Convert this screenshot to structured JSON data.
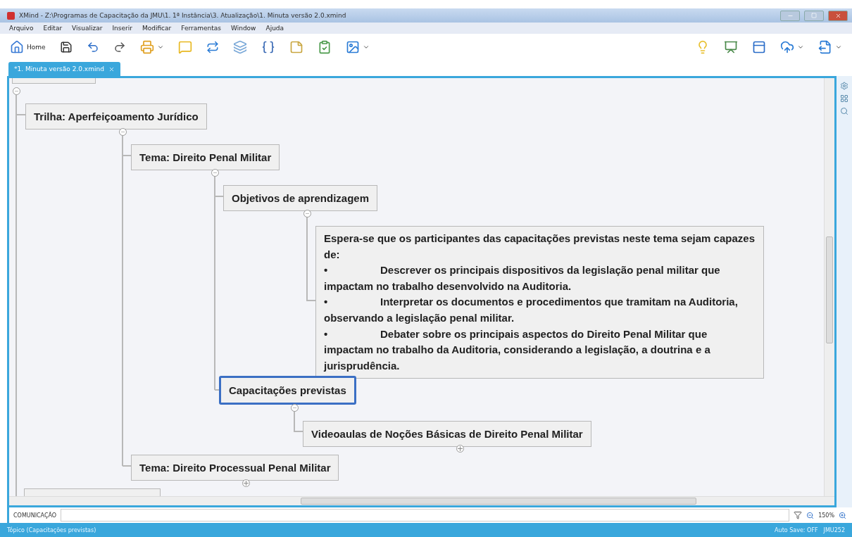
{
  "window": {
    "title": "XMind - Z:\\Programas de Capacitação da JMU\\1. 1ª Instância\\3. Atualização\\1. Minuta versão 2.0.xmind"
  },
  "menu": [
    "Arquivo",
    "Editar",
    "Visualizar",
    "Inserir",
    "Modificar",
    "Ferramentas",
    "Window",
    "Ajuda"
  ],
  "toolbar": {
    "home_label": "Home"
  },
  "tabs": [
    {
      "label": "*1. Minuta versão 2.0.xmind",
      "selected": true
    }
  ],
  "map": {
    "nodes": [
      {
        "kind": "topic",
        "label": "Trilha: Aperfeiçoamento Jurídico",
        "expanded": true,
        "selected": false
      },
      {
        "kind": "topic",
        "label": "Tema: Direito Penal Militar",
        "expanded": true,
        "selected": false
      },
      {
        "kind": "topic",
        "label": "Objetivos de aprendizagem",
        "expanded": true,
        "selected": false
      },
      {
        "kind": "note",
        "intro": "Espera-se que os participantes das capacitações previstas neste tema sejam capazes de:",
        "bullets": [
          {
            "bullet": "•",
            "text": "Descrever os principais dispositivos da legislação penal militar que impactam no trabalho desenvolvido na Auditoria."
          },
          {
            "bullet": "•",
            "text": "Interpretar os documentos e procedimentos que tramitam na Auditoria, observando a legislação penal militar."
          },
          {
            "bullet": "•",
            "text": "Debater sobre os principais aspectos do Direito Penal Militar que impactam no trabalho da Auditoria, considerando a legislação, a doutrina e a jurisprudência."
          }
        ],
        "selected": false
      },
      {
        "kind": "topic",
        "label": "Capacitações previstas",
        "expanded": true,
        "selected": true
      },
      {
        "kind": "topic",
        "label": "Videoaulas de Noções Básicas de Direito Penal Militar",
        "expanded": false,
        "selected": false
      },
      {
        "kind": "topic",
        "label": "Tema: Direito Processual Penal Militar",
        "expanded": false,
        "selected": false
      }
    ]
  },
  "filter_bar": {
    "label": "COMUNICAÇÃO",
    "zoom": "150%"
  },
  "status_bar": {
    "left": "Tópico (Capacitações previstas)",
    "auto_save": "Auto Save: OFF",
    "user": "JMU252"
  }
}
